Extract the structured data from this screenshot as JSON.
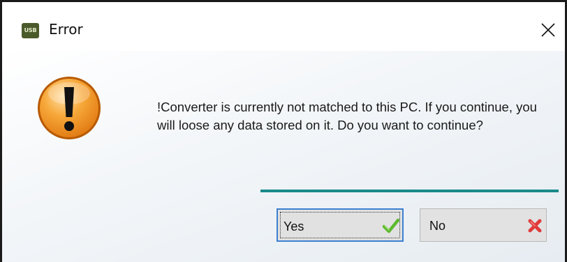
{
  "window": {
    "title": "Error",
    "app_icon_text": "USB"
  },
  "message": {
    "text": "!Converter is currently not matched to this PC. If you continue, you will loose any data stored on it. Do you want to continue?"
  },
  "buttons": {
    "yes_label": "Yes",
    "no_label": "No"
  },
  "icons": {
    "app": "usb-app-icon",
    "close": "close-icon",
    "warning": "warning-exclamation-icon",
    "yes": "green-checkmark-icon",
    "no": "red-x-icon"
  },
  "colors": {
    "separator": "#1a8a8a",
    "warning_orange": "#f39a2a",
    "focus_border": "#3c7fd0",
    "check_green": "#5cb82e",
    "x_red": "#e03a3a"
  }
}
